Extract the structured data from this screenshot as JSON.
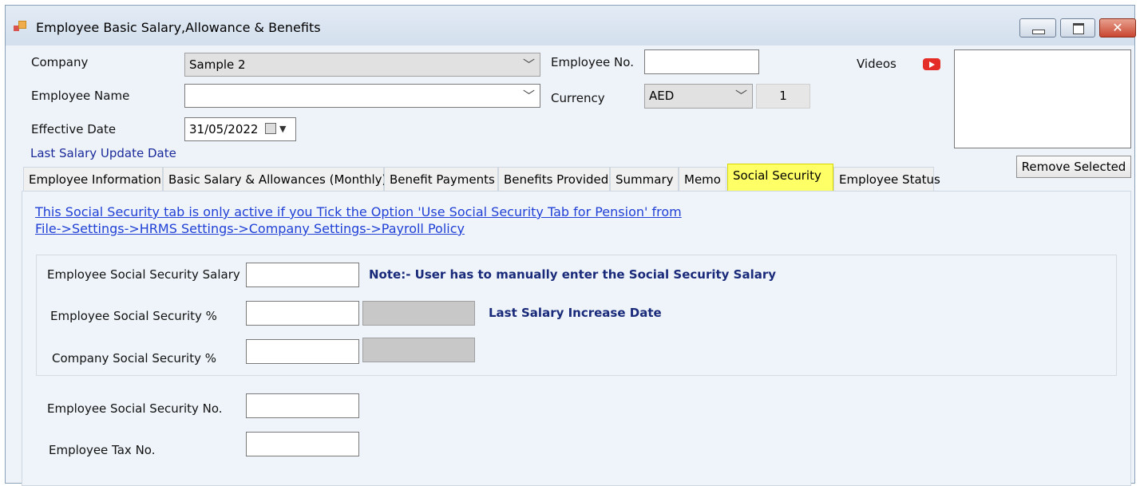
{
  "window": {
    "title": "Employee Basic Salary,Allowance & Benefits",
    "close_glyph": "✕"
  },
  "form": {
    "company_label": "Company",
    "company_value": "Sample 2",
    "employee_name_label": "Employee Name",
    "employee_name_value": "",
    "effective_date_label": "Effective Date",
    "effective_date_value": "31/05/2022",
    "last_salary_update_label": "Last Salary Update Date",
    "employee_no_label": "Employee No.",
    "employee_no_value": "",
    "currency_label": "Currency",
    "currency_value": "AED",
    "exchange_rate_value": "1",
    "videos_label": "Videos",
    "remove_selected_label": "Remove Selected"
  },
  "tabs": [
    {
      "label": "Employee Information"
    },
    {
      "label": "Basic Salary & Allowances (Monthly)"
    },
    {
      "label": "Benefit Payments"
    },
    {
      "label": "Benefits Provided"
    },
    {
      "label": "Summary"
    },
    {
      "label": "Memo"
    },
    {
      "label": "Social Security"
    },
    {
      "label": "Employee Status"
    }
  ],
  "social_security": {
    "info_link_line1": "This Social Security tab is only active if you  Tick the Option 'Use Social Security Tab for Pension' from",
    "info_link_line2": "File->Settings->HRMS Settings->Company Settings->Payroll Policy ",
    "emp_ss_salary_label": "Employee Social Security Salary",
    "emp_ss_salary_value": "",
    "note_text": "Note:- User has to manually enter the Social Security Salary",
    "emp_ss_pct_label": "Employee Social Security %",
    "emp_ss_pct_value": "",
    "last_salary_increase_label": "Last Salary Increase Date",
    "company_ss_pct_label": "Company Social Security %",
    "company_ss_pct_value": "",
    "emp_ss_no_label": "Employee Social Security No.",
    "emp_ss_no_value": "",
    "emp_tax_no_label": "Employee Tax No.",
    "emp_tax_no_value": ""
  },
  "colors": {
    "active_tab": "#ffff66",
    "link": "#1f3fd6",
    "note": "#1a2a7a"
  }
}
